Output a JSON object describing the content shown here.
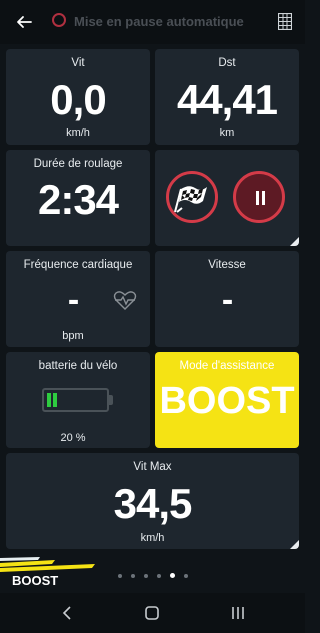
{
  "topbar": {
    "back_icon": "arrow-left-icon",
    "auto_pause_label": "Mise en pause automatique",
    "menu_icon": "grid-menu-icon"
  },
  "tiles": {
    "speed": {
      "label": "Vit",
      "value": "0,0",
      "unit": "km/h"
    },
    "distance": {
      "label": "Dst",
      "value": "44,41",
      "unit": "km"
    },
    "duration": {
      "label": "Durée de roulage",
      "value": "2:34"
    },
    "controls": {
      "finish_icon": "checkered-flag-icon",
      "pause_icon": "pause-icon"
    },
    "heart_rate": {
      "label": "Fréquence cardiaque",
      "value": "-",
      "unit": "bpm",
      "icon": "heart-pulse-icon"
    },
    "cadence": {
      "label": "Vitesse",
      "value": "-"
    },
    "battery": {
      "label": "batterie du vélo",
      "percent_text": "20 %",
      "level": 0.2
    },
    "assist_mode": {
      "label": "Mode d'assistance",
      "value": "BOOST"
    },
    "max_speed": {
      "label": "Vit Max",
      "value": "34,5",
      "unit": "km/h"
    }
  },
  "footer": {
    "mode_label": "BOOST",
    "page_count": 6,
    "active_page": 5
  },
  "colors": {
    "background": "#0f1418",
    "card": "#1e262e",
    "accent_red": "#d43b48",
    "assist_yellow": "#f5e314",
    "battery_green": "#2ecc40"
  },
  "system_nav": {
    "back_icon": "nav-back-icon",
    "home_icon": "nav-home-icon",
    "recents_icon": "nav-recents-icon"
  }
}
